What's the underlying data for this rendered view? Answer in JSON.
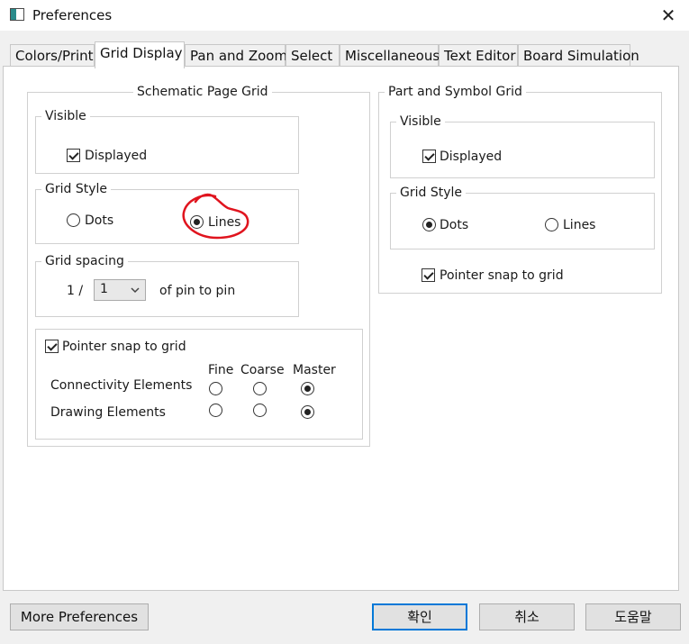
{
  "window": {
    "title": "Preferences",
    "close_glyph": "✕"
  },
  "tabs": [
    {
      "label": "Colors/Print",
      "active": false
    },
    {
      "label": "Grid Display",
      "active": true
    },
    {
      "label": "Pan and Zoom",
      "active": false
    },
    {
      "label": "Select",
      "active": false
    },
    {
      "label": "Miscellaneous",
      "active": false
    },
    {
      "label": "Text Editor",
      "active": false
    },
    {
      "label": "Board Simulation",
      "active": false
    }
  ],
  "schematic": {
    "title": "Schematic Page Grid",
    "visible": {
      "title": "Visible",
      "displayed_label": "Displayed",
      "displayed_checked": true
    },
    "grid_style": {
      "title": "Grid Style",
      "dots_label": "Dots",
      "lines_label": "Lines",
      "selected": "Lines"
    },
    "grid_spacing": {
      "title": "Grid spacing",
      "prefix": "1 /",
      "value": "1",
      "suffix": "of pin to pin"
    },
    "snap": {
      "label": "Pointer snap to grid",
      "checked": true,
      "columns": [
        "Fine",
        "Coarse",
        "Master"
      ],
      "rows": [
        {
          "label": "Connectivity Elements",
          "selected": "Master"
        },
        {
          "label": "Drawing Elements",
          "selected": "Master"
        }
      ]
    }
  },
  "part_symbol": {
    "title": "Part and Symbol Grid",
    "visible": {
      "title": "Visible",
      "displayed_label": "Displayed",
      "displayed_checked": true
    },
    "grid_style": {
      "title": "Grid Style",
      "dots_label": "Dots",
      "lines_label": "Lines",
      "selected": "Dots"
    },
    "snap": {
      "label": "Pointer snap to grid",
      "checked": true
    }
  },
  "buttons": {
    "more_preferences": "More Preferences",
    "ok": "확인",
    "cancel": "취소",
    "help": "도움말"
  },
  "colors": {
    "annotation": "#e0141e",
    "default_button_border": "#0078d7"
  },
  "icons": {
    "app": "app-window-icon",
    "close": "close-icon",
    "dropdown": "chevron-down-icon"
  }
}
